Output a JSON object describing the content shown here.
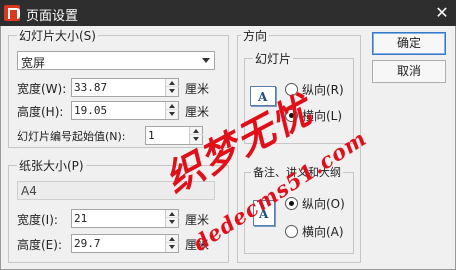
{
  "window": {
    "title": "页面设置",
    "close_glyph": "✕",
    "icons": {
      "app": "wps-presentation-icon",
      "close": "close-icon"
    }
  },
  "slide_size": {
    "legend": "幻灯片大小(S)",
    "selected": "宽屏",
    "width_label": "宽度(W):",
    "width_value": "33.87",
    "height_label": "高度(H):",
    "height_value": "19.05",
    "unit": "厘米",
    "start_number_label": "幻灯片编号起始值(N):",
    "start_number_value": "1"
  },
  "paper_size": {
    "legend": "纸张大小(P)",
    "selected": "A4",
    "width_label": "宽度(I):",
    "width_value": "21",
    "height_label": "高度(E):",
    "height_value": "29.7",
    "unit": "厘米"
  },
  "orientation": {
    "legend": "方向",
    "slides": {
      "legend": "幻灯片",
      "icon_glyph": "A",
      "portrait_label": "纵向(R)",
      "landscape_label": "横向(L)",
      "selected": "landscape"
    },
    "notes": {
      "legend": "备注、讲义和大纲",
      "icon_glyph": "A",
      "portrait_label": "纵向(O)",
      "landscape_label": "横向(A)",
      "selected": "portrait"
    }
  },
  "buttons": {
    "ok": "确定",
    "cancel": "取消"
  },
  "watermark": {
    "line1": "织梦无忧",
    "line2": "dedecms51.com",
    "color": "#e0101a"
  }
}
